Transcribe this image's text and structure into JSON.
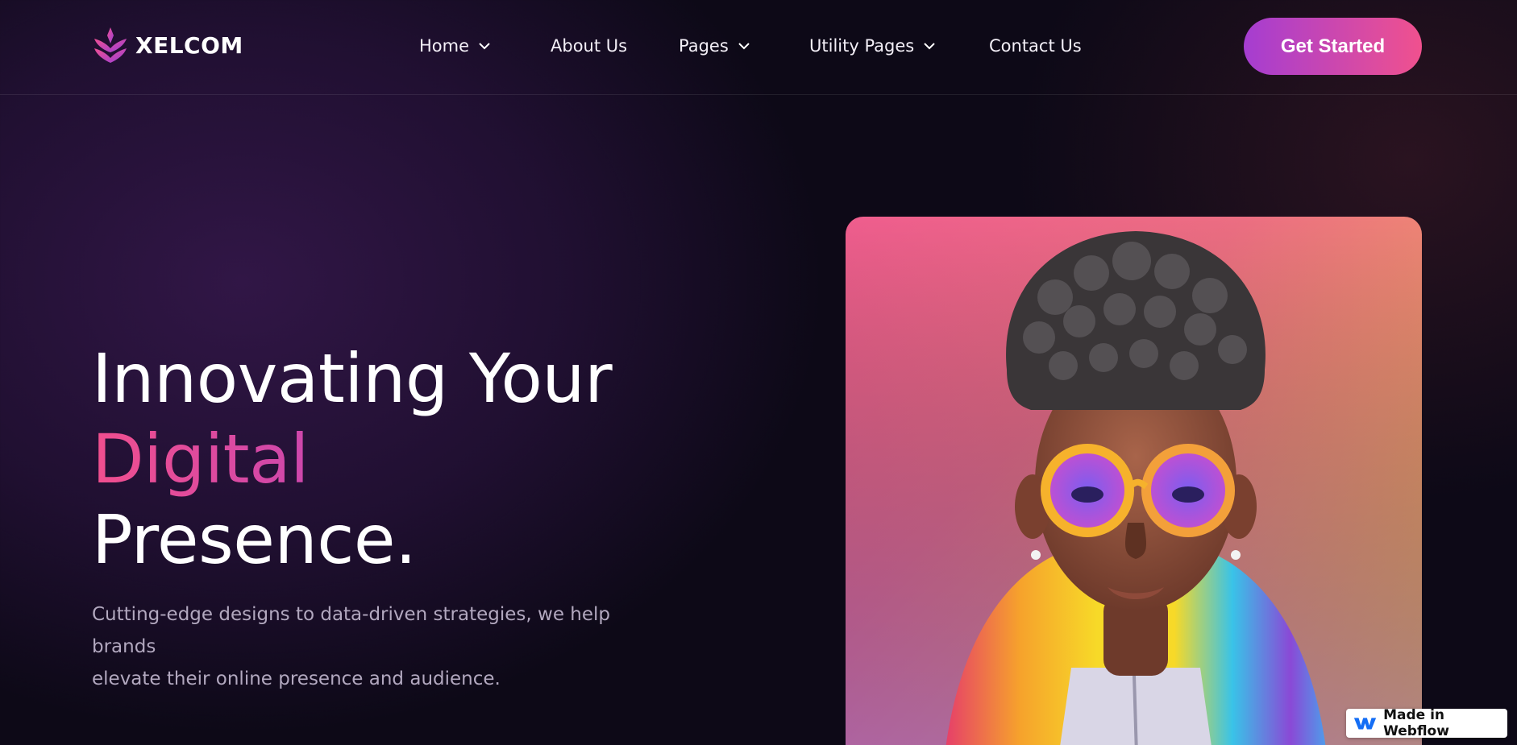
{
  "brand": {
    "name": "XELCOM",
    "logo_icon": "lotus-logo-icon"
  },
  "nav": {
    "items": [
      {
        "label": "Home",
        "has_dropdown": true
      },
      {
        "label": "About Us",
        "has_dropdown": false
      },
      {
        "label": "Pages",
        "has_dropdown": true
      },
      {
        "label": "Utility Pages",
        "has_dropdown": true
      },
      {
        "label": "Contact Us",
        "has_dropdown": false
      }
    ],
    "cta_label": "Get Started"
  },
  "hero": {
    "title_line1": "Innovating Your",
    "title_accent": "Digital",
    "title_line3": "Presence.",
    "subtitle_line1": "Cutting-edge designs to data-driven strategies, we help brands",
    "subtitle_line2": "elevate their online presence and audience.",
    "image": "3d-avatar-with-rainbow-glasses-and-jacket"
  },
  "badge": {
    "label": "Made in Webflow",
    "icon": "webflow-logo-icon"
  },
  "colors": {
    "accent_purple": "#a53dd1",
    "accent_pink": "#f0518e",
    "background": "#0d0917",
    "text_muted": "#b2a8bf"
  }
}
